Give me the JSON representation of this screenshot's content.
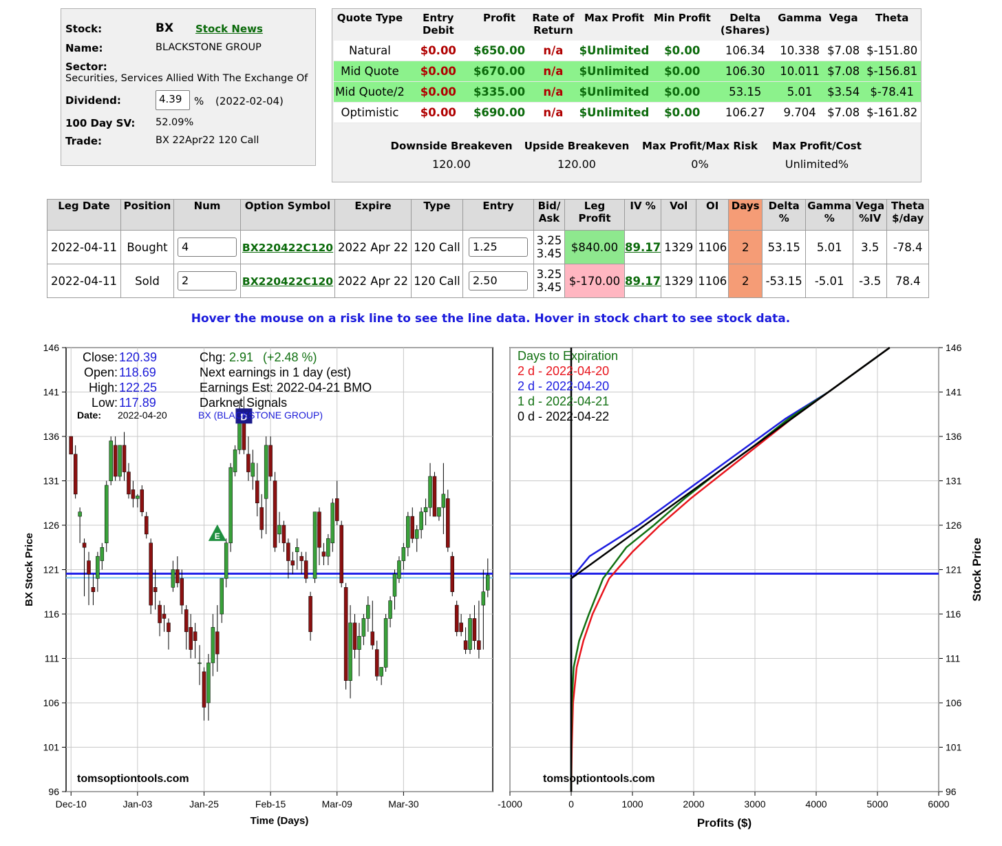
{
  "stock_info": {
    "stock_label": "Stock:",
    "ticker": "BX",
    "news_link": "Stock News",
    "name_label": "Name:",
    "name": "BLACKSTONE GROUP",
    "sector_label": "Sector:",
    "sector": "Securities, Services Allied With The Exchange Of",
    "dividend_label": "Dividend:",
    "dividend_value": "4.39",
    "dividend_unit": "%",
    "dividend_date": "(2022-02-04)",
    "sv_label": "100 Day SV:",
    "sv_value": "52.09%",
    "trade_label": "Trade:",
    "trade_value": "BX 22Apr22 120 Call"
  },
  "quote": {
    "headers": [
      "Quote Type",
      "Entry Debit",
      "Profit",
      "Rate of Return",
      "Max Profit",
      "Min Profit",
      "Delta (Shares)",
      "Gamma",
      "Vega",
      "Theta"
    ],
    "rows": [
      {
        "type": "Natural",
        "debit": "$0.00",
        "profit": "$650.00",
        "ror": "n/a",
        "max": "$Unlimited",
        "min": "$0.00",
        "delta": "106.34",
        "gamma": "10.338",
        "vega": "$7.08",
        "theta": "$-151.80",
        "highlight": false
      },
      {
        "type": "Mid Quote",
        "debit": "$0.00",
        "profit": "$670.00",
        "ror": "n/a",
        "max": "$Unlimited",
        "min": "$0.00",
        "delta": "106.30",
        "gamma": "10.011",
        "vega": "$7.08",
        "theta": "$-156.81",
        "highlight": true
      },
      {
        "type": "Mid Quote/2",
        "debit": "$0.00",
        "profit": "$335.00",
        "ror": "n/a",
        "max": "$Unlimited",
        "min": "$0.00",
        "delta": "53.15",
        "gamma": "5.01",
        "vega": "$3.54",
        "theta": "$-78.41",
        "highlight": true
      },
      {
        "type": "Optimistic",
        "debit": "$0.00",
        "profit": "$690.00",
        "ror": "n/a",
        "max": "$Unlimited",
        "min": "$0.00",
        "delta": "106.27",
        "gamma": "9.704",
        "vega": "$7.08",
        "theta": "$-161.82",
        "highlight": false
      }
    ],
    "summary": [
      {
        "label": "Downside Breakeven",
        "value": "120.00"
      },
      {
        "label": "Upside Breakeven",
        "value": "120.00"
      },
      {
        "label": "Max Profit/Max Risk",
        "value": "0%"
      },
      {
        "label": "Max Profit/Cost",
        "value": "Unlimited%"
      }
    ]
  },
  "legs": {
    "headers": [
      "Leg Date",
      "Position",
      "Num",
      "Option Symbol",
      "Expire",
      "Type",
      "Entry",
      "Bid/ Ask",
      "Leg Profit",
      "IV %",
      "Vol",
      "OI",
      "Days",
      "Delta %",
      "Gamma %",
      "Vega %IV",
      "Theta $/day"
    ],
    "rows": [
      {
        "date": "2022-04-11",
        "position": "Bought",
        "num": "4",
        "symbol": "BX220422C120",
        "expire": "2022 Apr 22",
        "type": "120 Call",
        "entry": "1.25",
        "bid": "3.25",
        "ask": "3.45",
        "leg_profit": "$840.00",
        "profit_color": "#8ee88e",
        "iv": "89.17",
        "vol": "1329",
        "oi": "1106",
        "days": "2",
        "delta": "53.15",
        "gamma": "5.01",
        "vega": "3.5",
        "theta": "-78.4"
      },
      {
        "date": "2022-04-11",
        "position": "Sold",
        "num": "2",
        "symbol": "BX220422C120",
        "expire": "2022 Apr 22",
        "type": "120 Call",
        "entry": "2.50",
        "bid": "3.25",
        "ask": "3.45",
        "leg_profit": "$-170.00",
        "profit_color": "#ffb6c1",
        "iv": "89.17",
        "vol": "1329",
        "oi": "1106",
        "days": "2",
        "delta": "-53.15",
        "gamma": "-5.01",
        "vega": "-3.5",
        "theta": "78.4"
      }
    ]
  },
  "hover_note": "Hover the mouse on a risk line to see the line data. Hover in stock chart to see stock data.",
  "colors": {
    "up": "#39a13a",
    "down": "#8b1010",
    "price_line": "#2020e8",
    "days_header": "#f59c76"
  },
  "chart_data": [
    {
      "type": "candlestick",
      "ylabel": "BX Stock Price",
      "xlabel": "Time (Days)",
      "ylim": [
        96,
        146
      ],
      "yticks": [
        96,
        101,
        106,
        111,
        116,
        121,
        126,
        131,
        136,
        141,
        146
      ],
      "xtick_labels": [
        "Dec-10",
        "Jan-03",
        "Jan-25",
        "Feb-15",
        "Mar-09",
        "Mar-30"
      ],
      "xtick_index": [
        0,
        15,
        30,
        45,
        60,
        75
      ],
      "close_label": "Close:",
      "close": "120.39",
      "open_label": "Open:",
      "open": "118.69",
      "high_label": "High:",
      "high": "122.25",
      "low_label": "Low:",
      "low": "117.89",
      "date_label": "Date:",
      "date": "2022-04-20",
      "chg_label": "Chg:",
      "chg": "2.91",
      "chg_pct": "(+2.48 %)",
      "next_earnings": "Next earnings in 1 day  (est)",
      "earnings_est": "Earnings Est: 2022-04-21 BMO",
      "signals": "Darknet Signals",
      "company": "BX (BLACKSTONE GROUP)",
      "watermark": "tomsoptiontools.com",
      "marker_e": "E",
      "marker_d": "D",
      "current_price": 120.39,
      "grid": true,
      "ohlc": [
        [
          136,
          135,
          134,
          134
        ],
        [
          134,
          135,
          129,
          129.5
        ],
        [
          127,
          128,
          124,
          127.5
        ],
        [
          124,
          124.5,
          118,
          123.5
        ],
        [
          122,
          123,
          117,
          120.5
        ],
        [
          119,
          120.5,
          117,
          118.5
        ],
        [
          120,
          123,
          118.5,
          122.5
        ],
        [
          122,
          124,
          121,
          123.5
        ],
        [
          124,
          131,
          123,
          130.5
        ],
        [
          131,
          136,
          130.5,
          135.5
        ],
        [
          135,
          136,
          131,
          131.5
        ],
        [
          131.5,
          135,
          131,
          135
        ],
        [
          135,
          136.5,
          131,
          132
        ],
        [
          132,
          133,
          129,
          129.5
        ],
        [
          130,
          131,
          128,
          129
        ],
        [
          129,
          129.5,
          128,
          129.3
        ],
        [
          130,
          130.5,
          127,
          127.5
        ],
        [
          127,
          127.5,
          124.5,
          125
        ],
        [
          124,
          124.5,
          116,
          117
        ],
        [
          119,
          121,
          116.5,
          118.5
        ],
        [
          117,
          117.5,
          113.5,
          115
        ],
        [
          116,
          117,
          114,
          115.5
        ],
        [
          115,
          115.5,
          112,
          114
        ],
        [
          119,
          122,
          118.5,
          121
        ],
        [
          121,
          122.5,
          119,
          119.5
        ],
        [
          120,
          121,
          116,
          117
        ],
        [
          116.5,
          117,
          112,
          114
        ],
        [
          114.5,
          116,
          111,
          112
        ],
        [
          114,
          115,
          111,
          113
        ],
        [
          110.5,
          112.5,
          108,
          110.5
        ],
        [
          109.5,
          110,
          104,
          105.5
        ],
        [
          106,
          111.5,
          104,
          110.5
        ],
        [
          110.5,
          116,
          109,
          114.5
        ],
        [
          114,
          117,
          109.5,
          111.5
        ],
        [
          116,
          120,
          115,
          120
        ],
        [
          120,
          124.5,
          119,
          124
        ],
        [
          124,
          133,
          123,
          132.5
        ],
        [
          132,
          135,
          131.5,
          134.5
        ],
        [
          134.5,
          140,
          134,
          139
        ],
        [
          139,
          140.5,
          134,
          134.5
        ],
        [
          134,
          136,
          131,
          132
        ],
        [
          131.5,
          134.5,
          130,
          133
        ],
        [
          131,
          133,
          127,
          128.5
        ],
        [
          128,
          129.5,
          124.5,
          125.5
        ],
        [
          129,
          136,
          125,
          135
        ],
        [
          135,
          136,
          131,
          131.5
        ],
        [
          131,
          132,
          123,
          123.5
        ],
        [
          125,
          127.5,
          124,
          126
        ],
        [
          126,
          126.5,
          123,
          124
        ],
        [
          124,
          124.5,
          120,
          122
        ],
        [
          122,
          123,
          120.5,
          121.5
        ],
        [
          123,
          124.5,
          121,
          123.5
        ],
        [
          122.5,
          123,
          120.5,
          122
        ],
        [
          122,
          123,
          119.5,
          120
        ],
        [
          118,
          118.5,
          113,
          114
        ],
        [
          120,
          127,
          119.5,
          127.5
        ],
        [
          127.5,
          128,
          121.5,
          123.5
        ],
        [
          123,
          124,
          121.5,
          122.5
        ],
        [
          122.5,
          125,
          121.5,
          124.5
        ],
        [
          124,
          129,
          123,
          128.5
        ],
        [
          129,
          131,
          126,
          126.5
        ],
        [
          126,
          126.5,
          119,
          119.5
        ],
        [
          119,
          119.5,
          107.5,
          108.5
        ],
        [
          108.5,
          117,
          106.5,
          115
        ],
        [
          115,
          116,
          111,
          112
        ],
        [
          112,
          115,
          109,
          113.5
        ],
        [
          113.5,
          116,
          112.5,
          115.5
        ],
        [
          115.5,
          118,
          114,
          117
        ],
        [
          114,
          117.5,
          112,
          112.5
        ],
        [
          112,
          113,
          108.5,
          109
        ],
        [
          109,
          110,
          108,
          110
        ],
        [
          110,
          116,
          109.5,
          115.5
        ],
        [
          115.5,
          118,
          114.5,
          117.5
        ],
        [
          118,
          121,
          116.5,
          120.5
        ],
        [
          120,
          122.5,
          119.5,
          122
        ],
        [
          122,
          124,
          121,
          123.5
        ],
        [
          123.5,
          127.5,
          122.5,
          127
        ],
        [
          127,
          128,
          124,
          124.5
        ],
        [
          124.5,
          126,
          123,
          125.5
        ],
        [
          125.5,
          128,
          124.5,
          127.5
        ],
        [
          127.5,
          129,
          126,
          128
        ],
        [
          128,
          133,
          127,
          131.5
        ],
        [
          131.5,
          132,
          127,
          127
        ],
        [
          127,
          128,
          126.5,
          128
        ],
        [
          128,
          133,
          125,
          129.5
        ],
        [
          129,
          130,
          123,
          123.5
        ],
        [
          122.5,
          123,
          118,
          118.5
        ],
        [
          117,
          117.5,
          113.5,
          114
        ],
        [
          115,
          116,
          113.5,
          114
        ],
        [
          113,
          114.5,
          111.5,
          112
        ],
        [
          112,
          116,
          111.5,
          115.5
        ],
        [
          115.5,
          117,
          112,
          113
        ],
        [
          113,
          117.5,
          111,
          112
        ],
        [
          117,
          121,
          112,
          118.5
        ],
        [
          118.69,
          122.25,
          117.89,
          120.39
        ]
      ]
    },
    {
      "type": "line",
      "ylabel": "Stock Price",
      "xlabel": "Profits ($)",
      "xlim": [
        -1000,
        6000
      ],
      "ylim": [
        96,
        146
      ],
      "xticks": [
        -1000,
        0,
        1000,
        2000,
        3000,
        4000,
        5000,
        6000
      ],
      "yticks": [
        96,
        101,
        106,
        111,
        116,
        121,
        126,
        131,
        136,
        141,
        146
      ],
      "legend_title": "Days to Expiration",
      "current_price": 120.39,
      "grid": true,
      "series": [
        {
          "name": "2 d - 2022-04-20",
          "color": "#e8141c",
          "points": [
            [
              0,
              96
            ],
            [
              10,
              101
            ],
            [
              30,
              106
            ],
            [
              90,
              110
            ],
            [
              200,
              113
            ],
            [
              350,
              116
            ],
            [
              620,
              120
            ],
            [
              1000,
              123
            ],
            [
              1450,
              126
            ],
            [
              1950,
              129
            ],
            [
              2500,
              132
            ],
            [
              3050,
              135
            ],
            [
              3600,
              138
            ],
            [
              4200,
              141
            ],
            [
              5000,
              145
            ],
            [
              5200,
              146
            ]
          ]
        },
        {
          "name": "2 d - 2022-04-20",
          "color": "#1c1ce0",
          "points": [
            [
              0,
              96
            ],
            [
              0,
              101
            ],
            [
              0,
              106
            ],
            [
              0,
              111
            ],
            [
              0,
              116
            ],
            [
              0,
              120
            ],
            [
              300,
              122.5
            ],
            [
              1100,
              126
            ],
            [
              1700,
              129
            ],
            [
              2300,
              132
            ],
            [
              2900,
              135
            ],
            [
              3500,
              138
            ],
            [
              4200,
              141
            ],
            [
              5000,
              145
            ],
            [
              5200,
              146
            ]
          ]
        },
        {
          "name": "1 d - 2022-04-21",
          "color": "#117011",
          "points": [
            [
              0,
              96
            ],
            [
              0,
              101
            ],
            [
              10,
              106
            ],
            [
              40,
              110
            ],
            [
              130,
              113
            ],
            [
              290,
              116
            ],
            [
              520,
              120
            ],
            [
              900,
              123.5
            ],
            [
              1350,
              126
            ],
            [
              1850,
              129
            ],
            [
              2400,
              132
            ],
            [
              3000,
              135
            ],
            [
              3550,
              138
            ],
            [
              4200,
              141
            ],
            [
              5000,
              145
            ],
            [
              5200,
              146
            ]
          ]
        },
        {
          "name": "0 d - 2022-04-22",
          "color": "#000000",
          "points": [
            [
              0,
              96
            ],
            [
              0,
              120
            ],
            [
              2400,
              132
            ],
            [
              4400,
              142
            ],
            [
              5200,
              146
            ]
          ]
        }
      ],
      "watermark": "tomsoptiontools.com"
    }
  ]
}
